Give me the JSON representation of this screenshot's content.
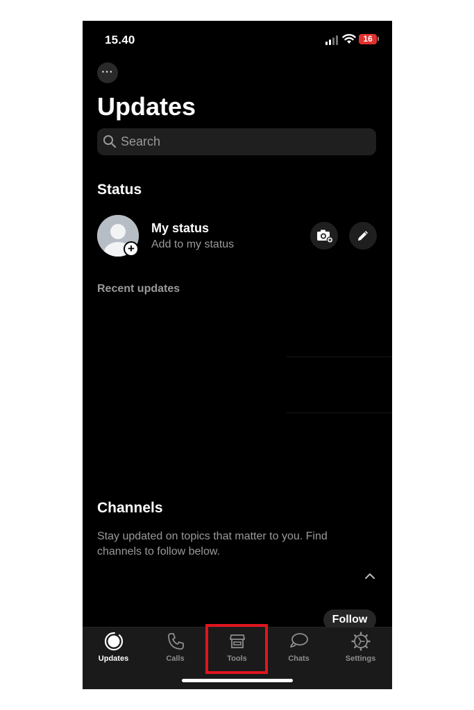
{
  "status_bar": {
    "time": "15.40",
    "battery_level": "16",
    "battery_color": "#e0312f"
  },
  "header": {
    "more_icon": "ellipsis-icon",
    "more_label": "···",
    "title": "Updates"
  },
  "search": {
    "placeholder": "Search",
    "value": "",
    "icon": "search-icon"
  },
  "status_section": {
    "heading": "Status",
    "my_status": {
      "title": "My status",
      "subtitle": "Add to my status",
      "add_badge": "+"
    },
    "actions": [
      "camera-icon",
      "pencil-icon"
    ],
    "recent_heading": "Recent updates"
  },
  "channels": {
    "heading": "Channels",
    "description": "Stay updated on topics that matter to you. Find channels to follow below.",
    "collapse_icon": "chevron-up-icon",
    "follow_label": "Follow"
  },
  "tab_bar": {
    "tabs": [
      {
        "label": "Updates",
        "icon": "updates-icon",
        "active": true
      },
      {
        "label": "Calls",
        "icon": "phone-icon",
        "active": false
      },
      {
        "label": "Tools",
        "icon": "storefront-icon",
        "active": false
      },
      {
        "label": "Chats",
        "icon": "chat-bubbles-icon",
        "active": false
      },
      {
        "label": "Settings",
        "icon": "gear-icon",
        "active": false
      }
    ],
    "highlighted_tab": "Tools",
    "highlight_color": "#e1141e"
  }
}
